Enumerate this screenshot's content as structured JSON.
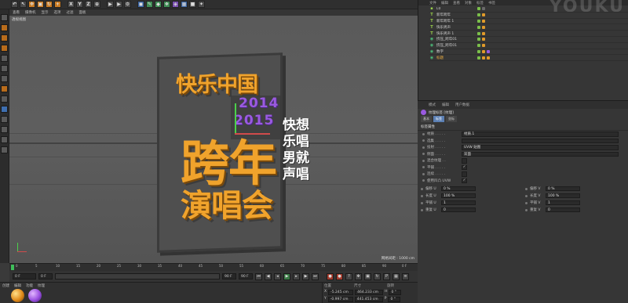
{
  "colors": {
    "accent_orange": "#f0a32c",
    "year_purple": "#9a5ae0",
    "selection_blue": "#5b7fb3",
    "panel_bg": "#363636"
  },
  "toolbar": {
    "buttons": [
      "X",
      "Y",
      "Z"
    ]
  },
  "viewport": {
    "menu": [
      "查看",
      "摄像机",
      "显示",
      "选项",
      "过滤",
      "面板"
    ],
    "view_label": "透视视图",
    "grid_scale": "网格间距 : 1000 cm"
  },
  "artwork": {
    "top_title": "快乐中国",
    "year_top": "2014",
    "year_bottom": "2015",
    "main_title_1": "跨年",
    "main_title_2": "演唱会",
    "side_lines": [
      "快想",
      "乐唱",
      "男就",
      "声唱"
    ]
  },
  "timeline": {
    "ticks": [
      "0",
      "5",
      "10",
      "15",
      "20",
      "25",
      "30",
      "35",
      "40",
      "45",
      "50",
      "55",
      "60",
      "65",
      "70",
      "75",
      "80",
      "85",
      "90"
    ],
    "end_frame": "0 F"
  },
  "transport": {
    "current_frame": "0 F",
    "start_field": "0 F",
    "end_field_a": "90 F",
    "end_field_b": "90 F"
  },
  "materials": {
    "menu": [
      "创建",
      "编辑",
      "功能",
      "纹理"
    ]
  },
  "coords": {
    "headers": [
      "位置",
      "尺寸",
      "旋转"
    ],
    "rows": [
      {
        "axis": "X",
        "pos": "-5.245 cm",
        "size": "464.233 cm",
        "rot_label": "H",
        "rot": "0 °"
      },
      {
        "axis": "Y",
        "pos": "-0.997 cm",
        "size": "441.453 cm",
        "rot_label": "P",
        "rot": "0 °"
      }
    ]
  },
  "object_manager": {
    "tabs": [
      "文件",
      "编辑",
      "查看",
      "对象",
      "标签",
      "书签"
    ],
    "watermark": "YOUKU",
    "objects": [
      {
        "name": "L0",
        "icon": "L0",
        "selected": false
      },
      {
        "name": "新年跨年",
        "icon": "T",
        "selected": false
      },
      {
        "name": "新年跨年 1",
        "icon": "T",
        "selected": false
      },
      {
        "name": "快乐男声",
        "icon": "T",
        "selected": false
      },
      {
        "name": "快乐男声 1",
        "icon": "T",
        "selected": false
      },
      {
        "name": "挤压_跨年01",
        "icon": "◉",
        "selected": false
      },
      {
        "name": "挤压_跨年01",
        "icon": "◉",
        "selected": false
      },
      {
        "name": "数字",
        "icon": "◉",
        "selected": false
      },
      {
        "name": "标题",
        "icon": "◉",
        "selected": true
      }
    ]
  },
  "attributes": {
    "tabs": [
      "模式",
      "编辑",
      "用户数据"
    ],
    "title": "纹理标签 [纹理]",
    "sub_tabs": [
      "基本",
      "标签",
      "坐标"
    ],
    "section": "标签属性",
    "props": [
      {
        "label": "材质 . . . . .",
        "value": "材质.1"
      },
      {
        "label": "选集 . . . . .",
        "value": ""
      },
      {
        "label": "投射 . . . . .",
        "value": "UVW 贴图"
      },
      {
        "label": "侧面 . . . . .",
        "value": "双面"
      },
      {
        "label": "混合纹理 . .",
        "value": ""
      },
      {
        "label": "平铺 . . . . .",
        "value": "✓"
      },
      {
        "label": "连续 . . . . .",
        "value": ""
      },
      {
        "label": "使用凹凸 UVW",
        "value": "✓"
      }
    ],
    "numbers": [
      {
        "label": "偏移 U",
        "value": "0 %"
      },
      {
        "label": "偏移 V",
        "value": "0 %"
      },
      {
        "label": "长度 U",
        "value": "100 %"
      },
      {
        "label": "长度 V",
        "value": "100 %"
      },
      {
        "label": "平铺 U",
        "value": "1"
      },
      {
        "label": "平铺 V",
        "value": "1"
      },
      {
        "label": "重复 U",
        "value": "0"
      },
      {
        "label": "重复 V",
        "value": "0"
      }
    ]
  }
}
